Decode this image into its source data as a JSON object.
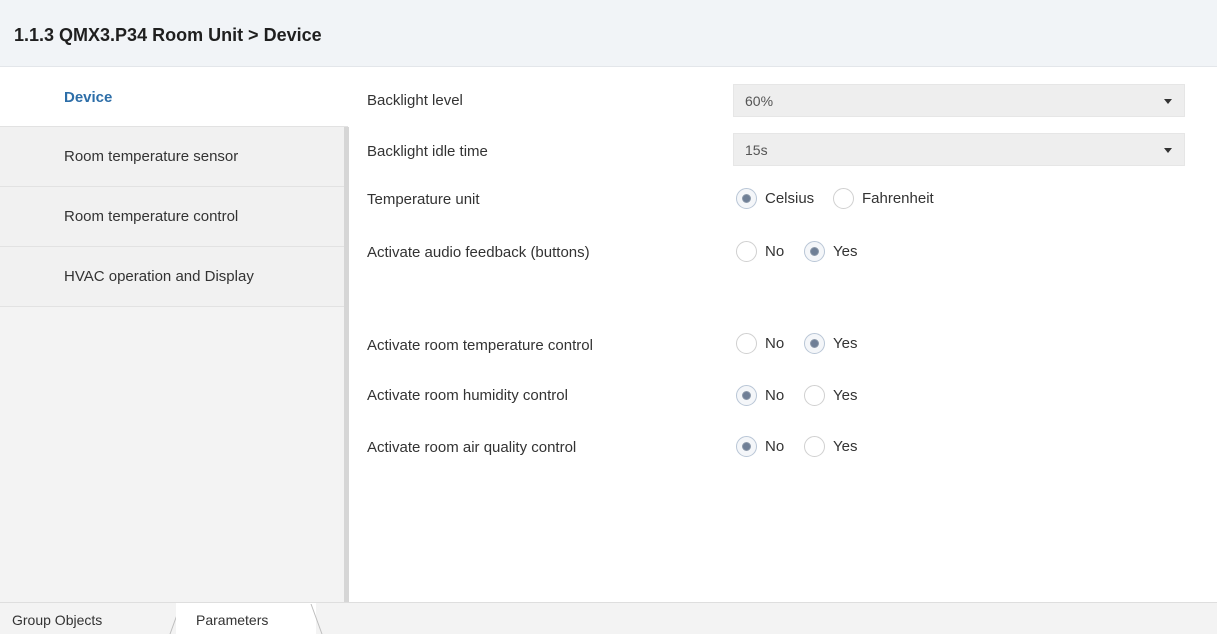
{
  "title": "1.1.3 QMX3.P34 Room Unit > Device",
  "sidebar": {
    "items": [
      {
        "label": "Device",
        "active": true
      },
      {
        "label": "Room temperature sensor",
        "active": false
      },
      {
        "label": "Room temperature control",
        "active": false
      },
      {
        "label": "HVAC operation and Display",
        "active": false
      }
    ]
  },
  "params": {
    "backlight_level": {
      "label": "Backlight level",
      "value": "60%"
    },
    "backlight_idle_time": {
      "label": "Backlight idle time",
      "value": "15s"
    },
    "temperature_unit": {
      "label": "Temperature unit",
      "options": [
        "Celsius",
        "Fahrenheit"
      ],
      "selected": "Celsius"
    },
    "audio_feedback": {
      "label": "Activate audio feedback (buttons)",
      "options": [
        "No",
        "Yes"
      ],
      "selected": "Yes"
    },
    "room_temp_control": {
      "label": "Activate room temperature control",
      "options": [
        "No",
        "Yes"
      ],
      "selected": "Yes"
    },
    "room_humidity_control": {
      "label": "Activate room humidity control",
      "options": [
        "No",
        "Yes"
      ],
      "selected": "No"
    },
    "room_air_quality_control": {
      "label": "Activate room air quality control",
      "options": [
        "No",
        "Yes"
      ],
      "selected": "No"
    }
  },
  "tabs": [
    {
      "label": "Group Objects",
      "active": false
    },
    {
      "label": "Parameters",
      "active": true
    }
  ],
  "colors": {
    "accent": "#2d6ea8",
    "title_bar": "#f1f4f7",
    "sidebar": "#f1f1f1",
    "radio_dot": "#6f7f96"
  }
}
